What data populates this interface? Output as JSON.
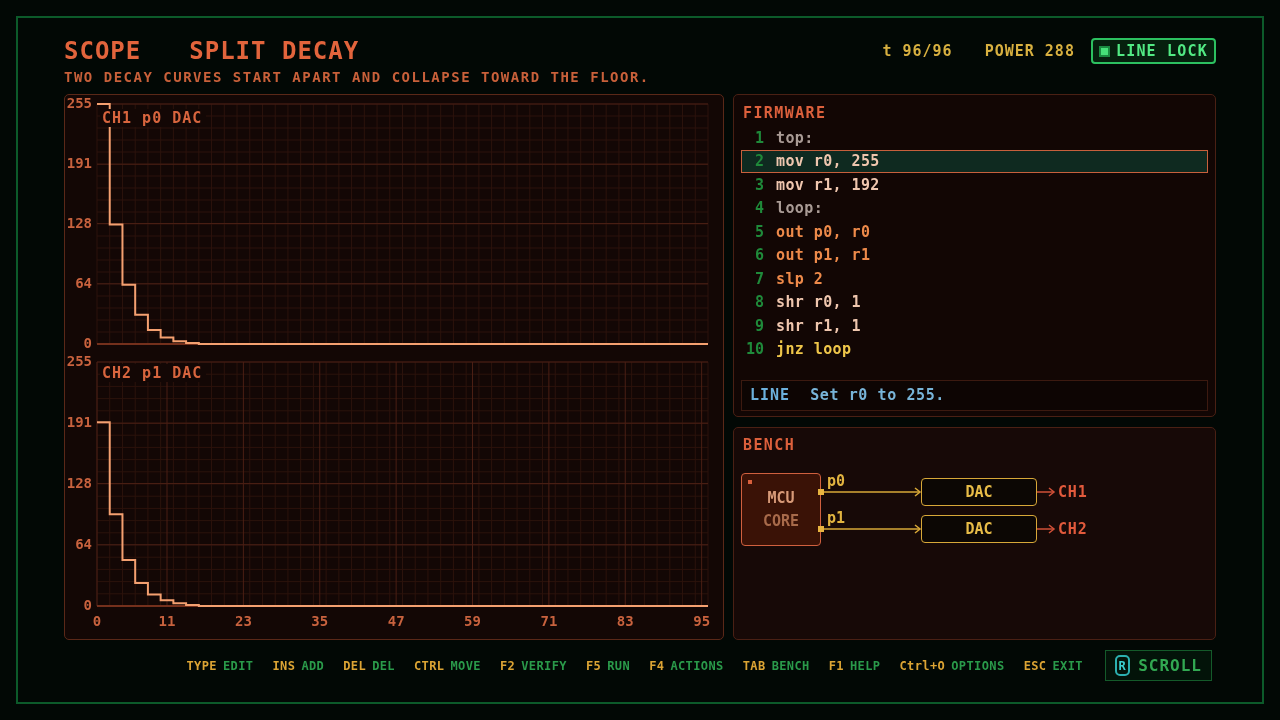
{
  "header": {
    "app": "SCOPE",
    "title": "SPLIT DECAY",
    "subtitle": "TWO DECAY CURVES START APART AND COLLAPSE TOWARD THE FLOOR.",
    "time": "t 96/96",
    "power": "POWER 288",
    "line_lock": {
      "label": "LINE LOCK",
      "on": true
    }
  },
  "scope": {
    "charts": [
      {
        "chart_data": {
          "type": "line",
          "title": "CH1 p0 DAC",
          "grid": true,
          "x": [
            0,
            2,
            2,
            4,
            4,
            6,
            6,
            8,
            8,
            10,
            10,
            12,
            12,
            14,
            14,
            16,
            16,
            96
          ],
          "series": [
            {
              "color": "#f4a070",
              "values": [
                255,
                255,
                127,
                127,
                63,
                63,
                31,
                31,
                15,
                15,
                7,
                7,
                3,
                3,
                1,
                1,
                0,
                0
              ]
            }
          ],
          "xlim": [
            0,
            96
          ],
          "ylim": [
            0,
            255
          ],
          "yticks": [
            0,
            64,
            128,
            191,
            255
          ]
        }
      },
      {
        "chart_data": {
          "type": "line",
          "title": "CH2 p1 DAC",
          "grid": true,
          "x": [
            0,
            2,
            2,
            4,
            4,
            6,
            6,
            8,
            8,
            10,
            10,
            12,
            12,
            14,
            14,
            16,
            16,
            96
          ],
          "series": [
            {
              "color": "#f4a070",
              "values": [
                192,
                192,
                96,
                96,
                48,
                48,
                24,
                24,
                12,
                12,
                6,
                6,
                3,
                3,
                1,
                1,
                0,
                0
              ]
            }
          ],
          "xlim": [
            0,
            96
          ],
          "ylim": [
            0,
            255
          ],
          "xticks": [
            0,
            11,
            23,
            35,
            47,
            59,
            71,
            83,
            95
          ],
          "yticks": [
            0,
            64,
            128,
            191,
            255
          ]
        }
      }
    ]
  },
  "firmware": {
    "title": "FIRMWARE",
    "lines": [
      {
        "number": "1",
        "code": "top:",
        "kind": "label",
        "selected": false
      },
      {
        "number": "2",
        "code": "mov r0, 255",
        "kind": "data",
        "selected": true
      },
      {
        "number": "3",
        "code": "mov r1, 192",
        "kind": "data",
        "selected": false
      },
      {
        "number": "4",
        "code": "loop:",
        "kind": "label",
        "selected": false
      },
      {
        "number": "5",
        "code": "out p0, r0",
        "kind": "io",
        "selected": false
      },
      {
        "number": "6",
        "code": "out p1, r1",
        "kind": "io",
        "selected": false
      },
      {
        "number": "7",
        "code": "slp 2",
        "kind": "io",
        "selected": false
      },
      {
        "number": "8",
        "code": "shr r0, 1",
        "kind": "data",
        "selected": false
      },
      {
        "number": "9",
        "code": "shr r1, 1",
        "kind": "data",
        "selected": false
      },
      {
        "number": "10",
        "code": "jnz loop",
        "kind": "branch",
        "selected": false
      }
    ],
    "info": {
      "label": "LINE",
      "text": "Set r0 to 255."
    }
  },
  "bench": {
    "title": "BENCH",
    "core": [
      "MCU",
      "CORE"
    ],
    "channels": [
      {
        "pin": "p0",
        "block": "DAC",
        "output": "CH1"
      },
      {
        "pin": "p1",
        "block": "DAC",
        "output": "CH2"
      }
    ]
  },
  "footer": {
    "hints": [
      {
        "key": "TYPE",
        "action": "EDIT"
      },
      {
        "key": "INS",
        "action": "ADD"
      },
      {
        "key": "DEL",
        "action": "DEL"
      },
      {
        "key": "CTRL",
        "action": "MOVE"
      },
      {
        "key": "F2",
        "action": "VERIFY"
      },
      {
        "key": "F5",
        "action": "RUN"
      },
      {
        "key": "F4",
        "action": "ACTIONS"
      },
      {
        "key": "TAB",
        "action": "BENCH"
      },
      {
        "key": "F1",
        "action": "HELP"
      },
      {
        "key": "Ctrl+O",
        "action": "OPTIONS"
      },
      {
        "key": "ESC",
        "action": "EXIT"
      }
    ],
    "scroll_button": {
      "key": "R",
      "label": "SCROLL"
    }
  }
}
